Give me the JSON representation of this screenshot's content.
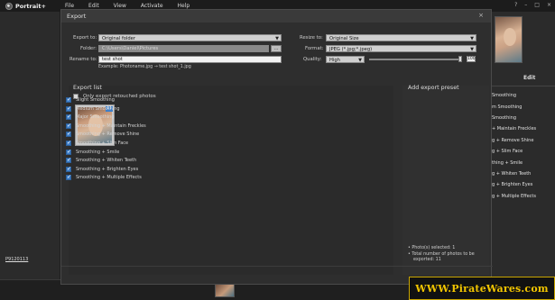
{
  "app": {
    "name": "Portrait+"
  },
  "menu": [
    "File",
    "Edit",
    "View",
    "Activate",
    "Help"
  ],
  "window_controls": [
    "?",
    "–",
    "□",
    "×"
  ],
  "dialog": {
    "title": "Export",
    "close_label": "×",
    "export_to_label": "Export to:",
    "export_to_value": "Original folder",
    "folder_label": "Folder:",
    "folder_value": "C:\\Users\\Daniel\\Pictures",
    "browse_label": "...",
    "rename_label": "Rename to:",
    "rename_value": "test shot",
    "example_text": "Example: Photoname.jpg → test shot_1.jpg",
    "resize_label": "Resize to:",
    "resize_value": "Original Size",
    "format_label": "Format:",
    "format_value": "JPEG (*.jpg;*.jpeg)",
    "quality_label": "Quality:",
    "quality_value": "High",
    "quality_number": "100",
    "quality_fraction": 1.0,
    "export_list_title": "Export list",
    "only_retouched_label": "Only export retouched photos",
    "only_retouched_checked": false,
    "thumbnail_badge": "11",
    "presets_title": "Add export preset",
    "presets": [
      {
        "label": "Slight Smoothing",
        "checked": true
      },
      {
        "label": "Medium Smoothing",
        "checked": true
      },
      {
        "label": "Major Smoothing",
        "checked": true
      },
      {
        "label": "Smoothing + Maintain Freckles",
        "checked": true
      },
      {
        "label": "Smoothing + Remove Shine",
        "checked": true
      },
      {
        "label": "Smoothing + Slim Face",
        "checked": true
      },
      {
        "label": "Smoothing + Smile",
        "checked": true
      },
      {
        "label": "Smoothing + Whiten Teeth",
        "checked": true
      },
      {
        "label": "Smoothing + Brighten Eyes",
        "checked": true
      },
      {
        "label": "Smoothing + Multiple Effects",
        "checked": true
      }
    ],
    "summary_selected": "• Photo(s) selected: 1",
    "summary_total_1": "• Total number of photos to be",
    "summary_total_2": "exported: 11"
  },
  "right_panel": {
    "edit_label": "Edit",
    "items": [
      "Smoothing",
      "m Smoothing",
      "Smoothing",
      "+ Maintain Freckles",
      "g + Remove Shine",
      "g + Slim Face",
      "thing + Smile",
      "g + Whiten Teeth",
      "g + Brighten Eyes",
      "g + Multiple Effects"
    ]
  },
  "left_panel": {
    "photo_id": "P9120113"
  },
  "watermark": "WWW.PirateWares.com",
  "colors": {
    "accent": "#3f7fc8",
    "watermark": "#f2c500"
  }
}
